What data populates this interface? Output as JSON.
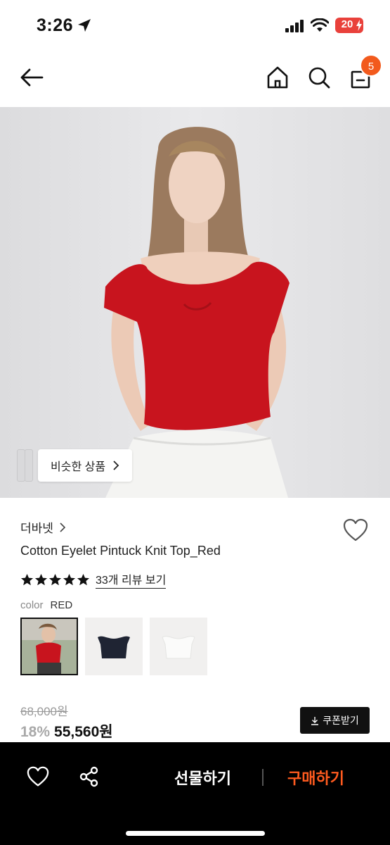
{
  "status_bar": {
    "time": "3:26",
    "battery": "20"
  },
  "header": {
    "cart_count": "5"
  },
  "hero": {
    "similar_label": "비슷한 상품"
  },
  "product": {
    "brand": "더바넷",
    "name": "Cotton Eyelet Pintuck Knit Top_Red",
    "rating_stars": 5,
    "review_link": "33개 리뷰 보기",
    "color_label": "color",
    "color_value": "RED",
    "original_price": "68,000원",
    "discount": "18%",
    "sale_price": "55,560원",
    "coupon_label": "쿠폰받기"
  },
  "bottom_bar": {
    "gift_label": "선물하기",
    "buy_label": "구매하기"
  },
  "colors": {
    "accent": "#ff5b1f",
    "badge": "#f25a1d",
    "product_red": "#c8141e"
  },
  "icons": [
    "arrow-left-icon",
    "home-icon",
    "search-icon",
    "shopping-bag-icon",
    "heart-icon",
    "star-icon",
    "share-icon",
    "download-icon"
  ]
}
